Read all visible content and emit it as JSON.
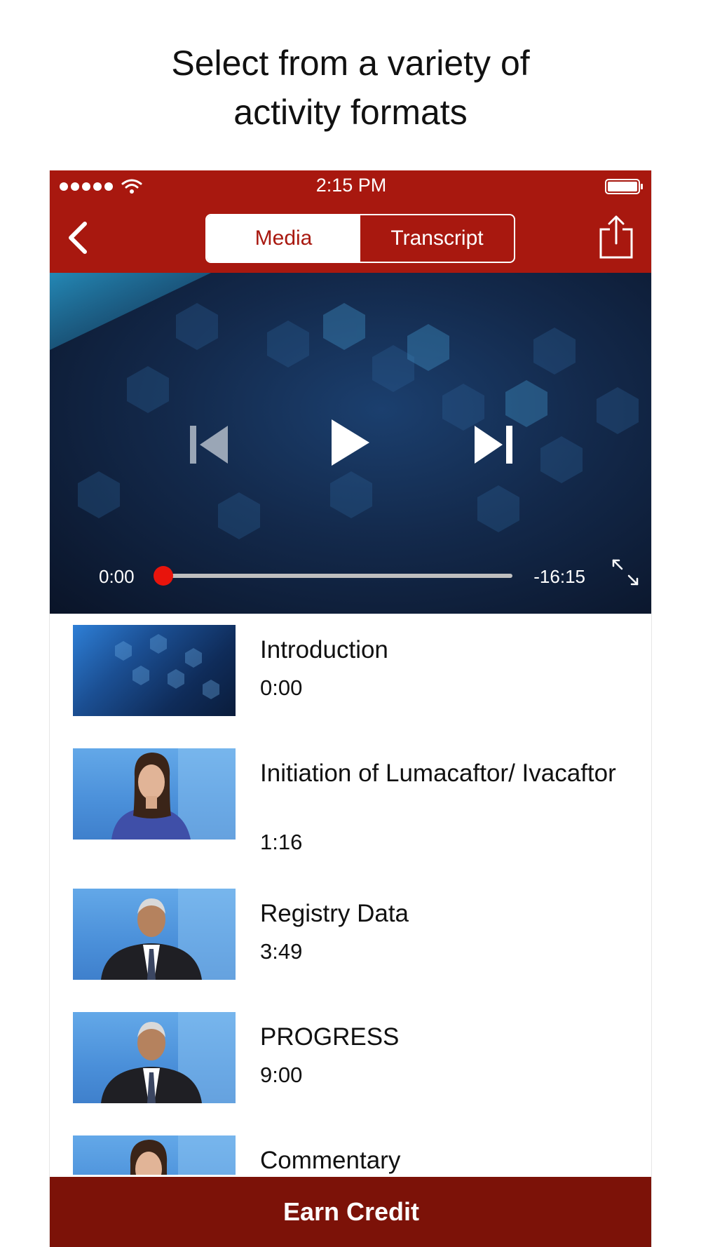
{
  "headline": {
    "line1": "Select from a variety of",
    "line2": "activity formats"
  },
  "status_bar": {
    "time": "2:15 PM",
    "signal_icon": "signal-dots-icon",
    "wifi_icon": "wifi-icon",
    "battery_icon": "battery-icon"
  },
  "nav": {
    "back_icon": "chevron-left-icon",
    "tabs": [
      {
        "label": "Media",
        "selected": true
      },
      {
        "label": "Transcript",
        "selected": false
      }
    ],
    "share_icon": "share-icon"
  },
  "player": {
    "current_time": "0:00",
    "remaining_time": "-16:15",
    "progress": 0.0,
    "prev_icon": "skip-back-icon",
    "play_icon": "play-icon",
    "next_icon": "skip-forward-icon",
    "fullscreen_icon": "expand-icon"
  },
  "chapters": [
    {
      "title": "Introduction",
      "time": "0:00"
    },
    {
      "title": "Initiation of Lumacaftor/ Ivacaftor",
      "time": "1:16"
    },
    {
      "title": "Registry Data",
      "time": "3:49"
    },
    {
      "title": "PROGRESS",
      "time": "9:00"
    },
    {
      "title": "Commentary",
      "time": ""
    }
  ],
  "footer": {
    "button_label": "Earn Credit"
  },
  "colors": {
    "brand_red": "#a8180f",
    "footer_red": "#7c1208",
    "scrubber": "#e8140c"
  }
}
